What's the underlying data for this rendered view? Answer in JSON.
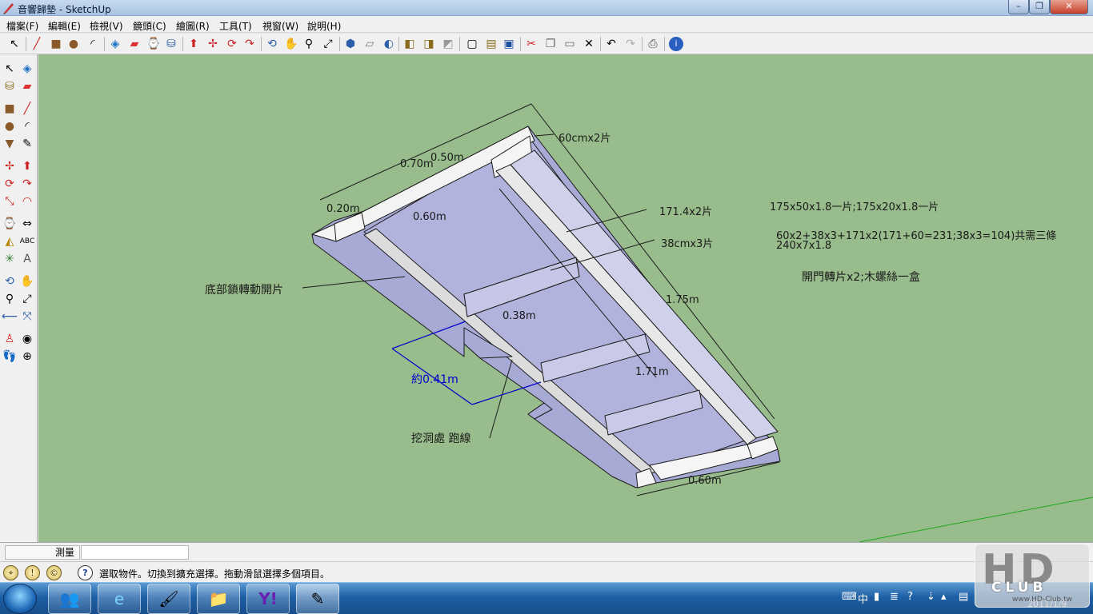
{
  "window": {
    "title": "音響歸墊 - SketchUp",
    "min": "–",
    "max": "❐",
    "close": "✕"
  },
  "menu": [
    "檔案(F)",
    "編輯(E)",
    "檢視(V)",
    "鏡頭(C)",
    "繪圖(R)",
    "工具(T)",
    "視窗(W)",
    "說明(H)"
  ],
  "toolbar_icons": [
    "select-icon",
    "line-icon",
    "rectangle-icon",
    "circle-icon",
    "arc-icon",
    "make-component-icon",
    "eraser-icon",
    "tape-measure-icon",
    "paint-bucket-icon",
    "push-pull-icon",
    "move-icon",
    "rotate-icon",
    "follow-me-icon",
    "orbit-icon",
    "pan-icon",
    "zoom-icon",
    "zoom-extents-icon",
    "iso-view-icon",
    "top-view-icon",
    "front-view-icon",
    "xray-icon",
    "wireframe-icon",
    "shaded-icon",
    "textured-icon",
    "new-icon",
    "open-icon",
    "save-icon",
    "cut-icon",
    "copy-icon",
    "paste-icon",
    "delete-icon",
    "undo-icon",
    "redo-icon",
    "print-icon",
    "help-icon"
  ],
  "annotations": {
    "top_60": "60cmx2片",
    "dim_050": "0.50m",
    "dim_070": "0.70m",
    "dim_020": "0.20m",
    "dim_060_top": "0.60m",
    "dim_1714": "171.4x2片",
    "dim_38cm": "38cmx3片",
    "dim_175": "1.75m",
    "dim_038": "0.38m",
    "dim_171": "1.71m",
    "dim_060_bottom": "0.60m",
    "bottom_hinge": "底部鎖轉動開片",
    "approx_041": "約0.41m",
    "hole_note": "挖洞處 跑線",
    "note1": "175x50x1.8一片;175x20x1.8一片",
    "note2": "60x2+38x3+171x2(171+60=231;38x3=104)共需三條",
    "note3": "240x7x1.8",
    "note4": "開門轉片x2;木螺絲一盒"
  },
  "measure": {
    "label": "測量",
    "value": ""
  },
  "status": {
    "text": "選取物件。切換到擴充選擇。拖動滑鼠選擇多個項目。",
    "icons": [
      "geo-location-icon",
      "credits-icon",
      "copyright-icon",
      "instructor-icon"
    ]
  },
  "taskbar": {
    "apps": [
      "user-accounts-app-icon",
      "internet-explorer-icon",
      "paint-app-icon",
      "folder-explorer-icon",
      "yahoo-messenger-icon",
      "sketchup-taskbar-icon"
    ],
    "ime": "中",
    "clock_date": "2011/1/9"
  },
  "watermark": {
    "main": "HD",
    "club": "CLUB",
    "url": "www.HD-Club.tw"
  },
  "colors": {
    "viewport_bg": "#98bc8b",
    "face_blue": "#a5a7d4",
    "face_white": "#f5f5f5",
    "edge": "#1b1b1b",
    "dim_blue": "#0000cc"
  }
}
